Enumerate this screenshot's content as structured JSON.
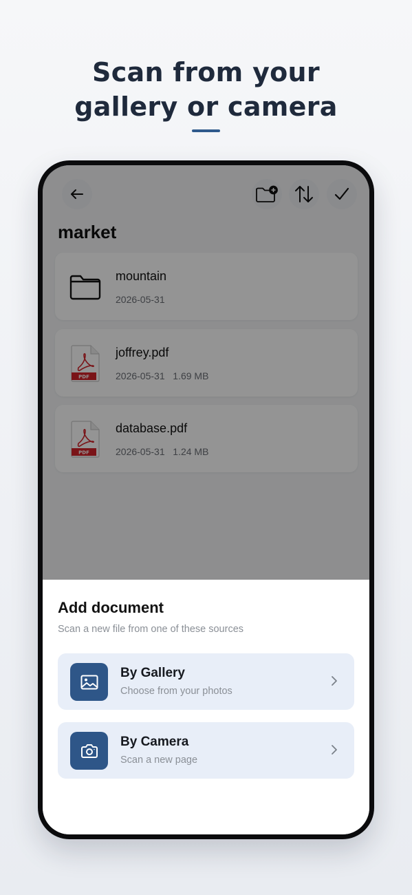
{
  "headline": {
    "line1": "Scan from your",
    "line2": "gallery or camera"
  },
  "toolbar": {
    "back_icon": "arrow-left-icon",
    "new_folder_icon": "folder-plus-icon",
    "sort_icon": "sort-arrows-icon",
    "select_icon": "check-icon"
  },
  "folder": {
    "title": "market"
  },
  "files": [
    {
      "name": "mountain",
      "meta": "2026-05-31",
      "icon": "folder-icon"
    },
    {
      "name": "joffrey.pdf",
      "meta": "2026-05-31   1.69 MB",
      "icon": "pdf-file-icon",
      "badge": "PDF"
    },
    {
      "name": "database.pdf",
      "meta": "2026-05-31   1.24 MB",
      "icon": "pdf-file-icon",
      "badge": "PDF"
    }
  ],
  "sheet": {
    "title": "Add document",
    "subtitle": "Scan a new file from one of these sources",
    "options": [
      {
        "title": "By Gallery",
        "subtitle": "Choose from your photos",
        "icon": "image-icon"
      },
      {
        "title": "By Camera",
        "subtitle": "Scan a new page",
        "icon": "camera-icon"
      }
    ]
  },
  "colors": {
    "accent": "#2e5688",
    "option_bg": "#e8eef8",
    "headline": "#1f2a3c",
    "pdf_red": "#d2232a"
  }
}
